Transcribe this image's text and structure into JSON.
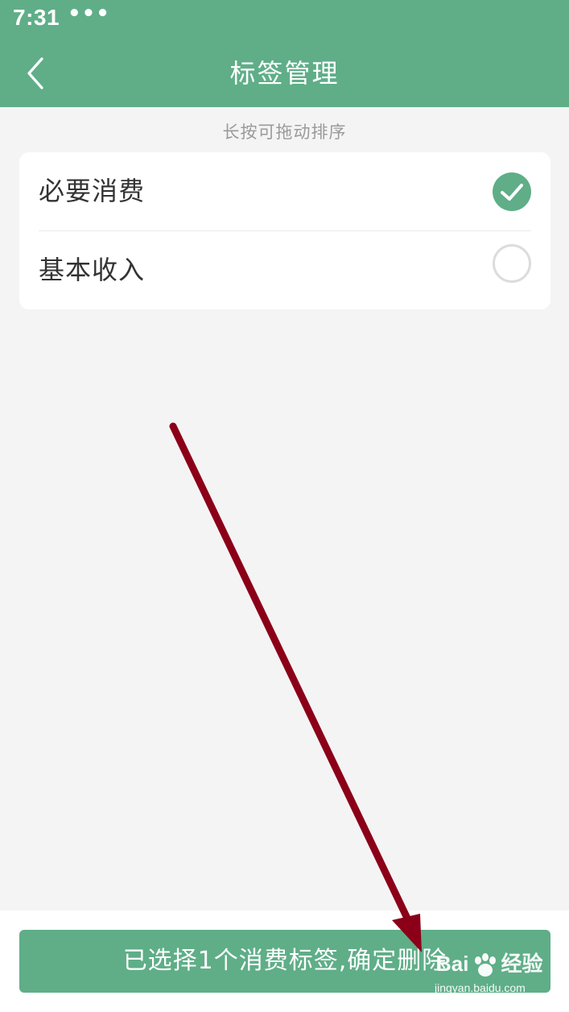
{
  "status_bar": {
    "time": "7:31",
    "dots": "•••"
  },
  "header": {
    "back_icon": "chevron-left-icon",
    "title": "标签管理"
  },
  "hint": "长按可拖动排序",
  "tags": [
    {
      "label": "必要消费",
      "selected": true
    },
    {
      "label": "基本收入",
      "selected": false
    }
  ],
  "bottom": {
    "delete_label": "已选择1个消费标签,确定删除"
  },
  "annotation": {
    "arrow_color": "#8b0018"
  },
  "watermark": {
    "brand": "Bai",
    "brand_tail": "经验",
    "url": "jingyan.baidu.com"
  },
  "colors": {
    "accent": "#5fae88",
    "background": "#f4f4f4"
  }
}
